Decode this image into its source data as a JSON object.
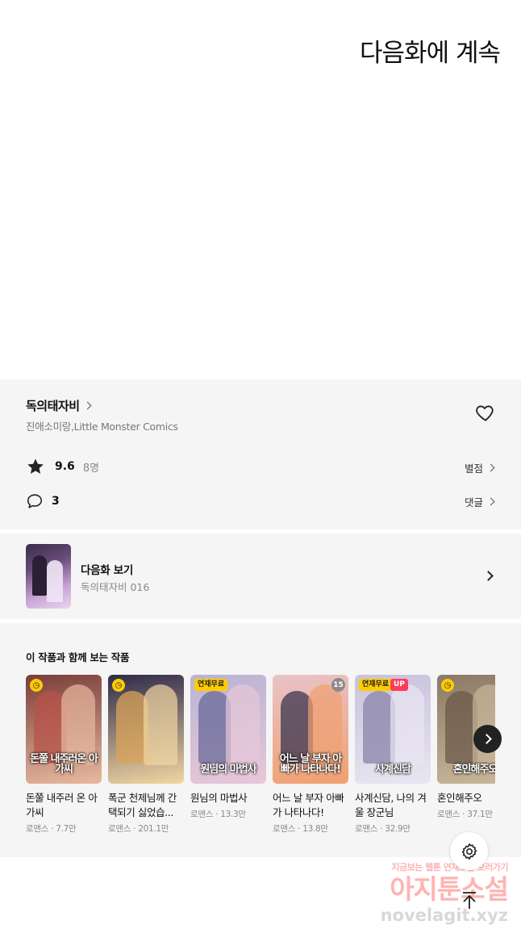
{
  "continue_text": "다음화에 계속",
  "series": {
    "title": "독의태자비",
    "authors": "진애소미랑,Little Monster Comics",
    "rating": "9.6",
    "rating_count": "8명",
    "rating_link": "별점",
    "comment_count": "3",
    "comment_link": "댓글"
  },
  "next_episode": {
    "label": "다음화 보기",
    "subtitle": "독의태자비 016"
  },
  "recommendations": {
    "heading": "이 작품과 함께 보는 작품",
    "items": [
      {
        "title": "돈쭐 내주러 온 아가씨",
        "meta": "로맨스 · 7.7만",
        "cover_text": "돈쭐 내주러온 아가씨",
        "badge": "clock",
        "color_a": "#b8534a",
        "color_b": "#e8b9a0",
        "bg": "#7a3e3a"
      },
      {
        "title": "폭군 천제님께 간택되기 싫었습...",
        "meta": "로맨스 · 201.1만",
        "cover_text": "",
        "badge": "clock",
        "color_a": "#d9a35a",
        "color_b": "#f2d7a2",
        "bg": "#2f2a4a"
      },
      {
        "title": "원님의 마법사",
        "meta": "로맨스 · 13.3만",
        "cover_text": "원님의 마법사",
        "badge": "free",
        "badge_text": "연재무료",
        "color_a": "#6a6a9a",
        "color_b": "#e7c7d8",
        "bg": "#b9b4d4"
      },
      {
        "title": "어느 날 부자 아빠가 나타나다!",
        "meta": "로맨스 · 13.8만",
        "cover_text": "어느 날 부자 아빠가 나타나다!",
        "badge": "num",
        "badge_text": "15",
        "color_a": "#3a3550",
        "color_b": "#f0a070",
        "bg": "#e8c3c8"
      },
      {
        "title": "사계신담, 나의 겨울 장군님",
        "meta": "로맨스 · 32.9만",
        "cover_text": "사계신담",
        "badge": "free-up",
        "badge_text": "연재무료",
        "up_text": "UP",
        "color_a": "#8a84a8",
        "color_b": "#e9e6f2",
        "bg": "#c8c2dc"
      },
      {
        "title": "혼인해주오",
        "meta": "로맨스 · 37.1만",
        "cover_text": "혼인해주오",
        "badge": "clock",
        "color_a": "#6a5a48",
        "color_b": "#c9b79a",
        "bg": "#8b7a66"
      }
    ]
  },
  "watermark": {
    "line1": "지금보는 웹툰 연재소설 보러가기",
    "line2": "아지툰소설",
    "line3": "novelagit.xyz"
  }
}
